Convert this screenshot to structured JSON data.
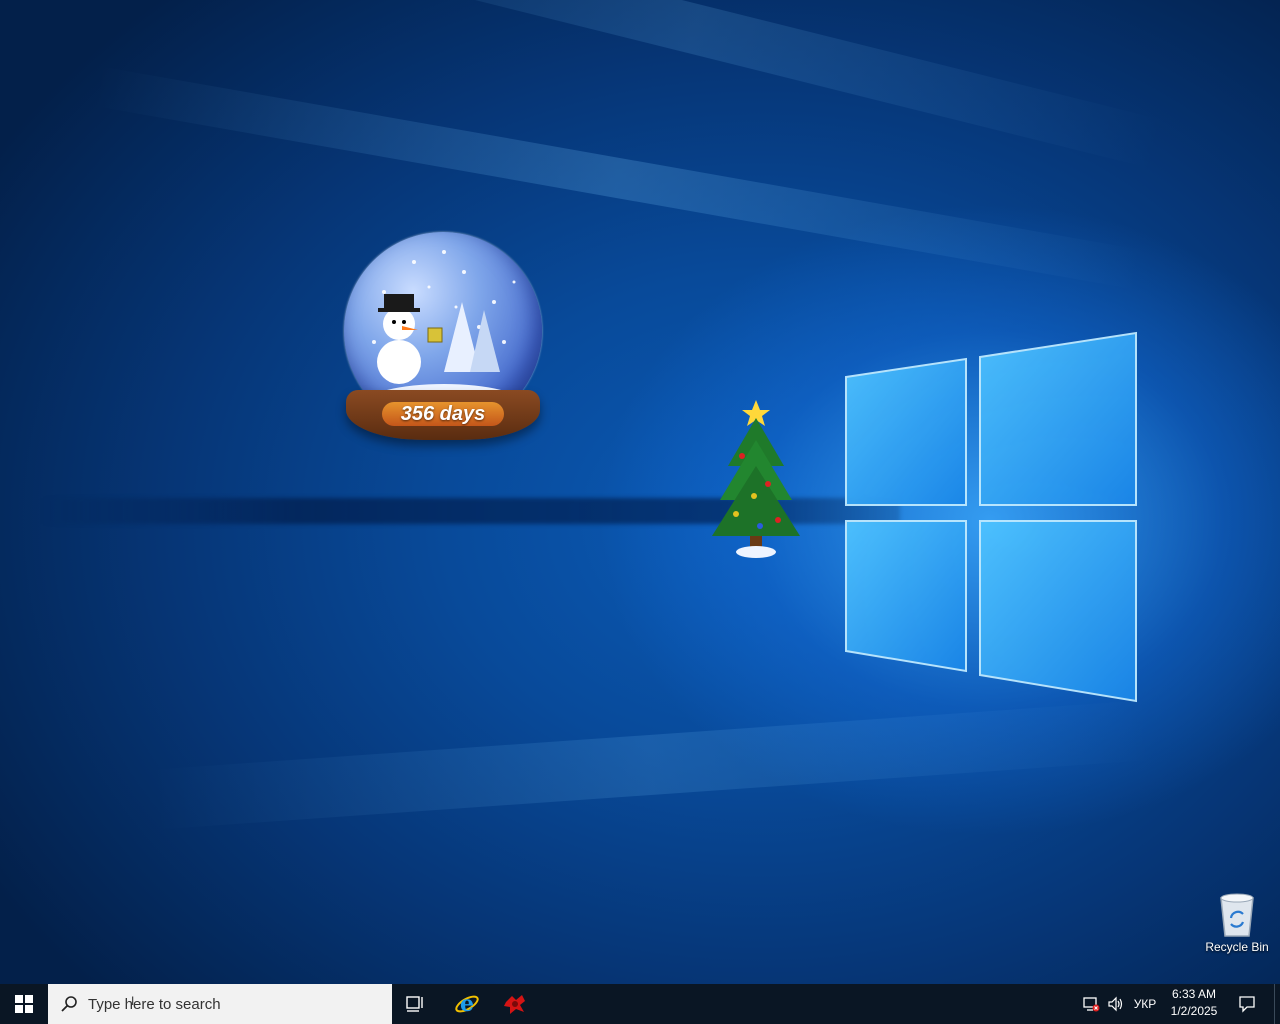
{
  "desktop": {
    "gadgets": {
      "snow_globe_counter": "356 days"
    },
    "icons": [
      {
        "label": "Recycle Bin",
        "icon": "recycle-bin-icon"
      }
    ]
  },
  "taskbar": {
    "start_icon": "windows-logo-icon",
    "search_placeholder": "Type here to search",
    "pinned": [
      {
        "name": "Task View",
        "icon": "task-view-icon"
      },
      {
        "name": "Internet Explorer",
        "icon": "internet-explorer-icon"
      },
      {
        "name": "App",
        "icon": "red-app-icon"
      }
    ],
    "tray": {
      "network_icon": "network-disconnected-icon",
      "volume_icon": "speaker-icon",
      "language": "УКР",
      "time": "6:33 AM",
      "date": "1/2/2025",
      "notifications_icon": "action-center-icon"
    }
  },
  "colors": {
    "taskbar": "#0a1624",
    "search_box": "#f2f2f2",
    "wallpaper_glow": "#3aa8ff"
  }
}
